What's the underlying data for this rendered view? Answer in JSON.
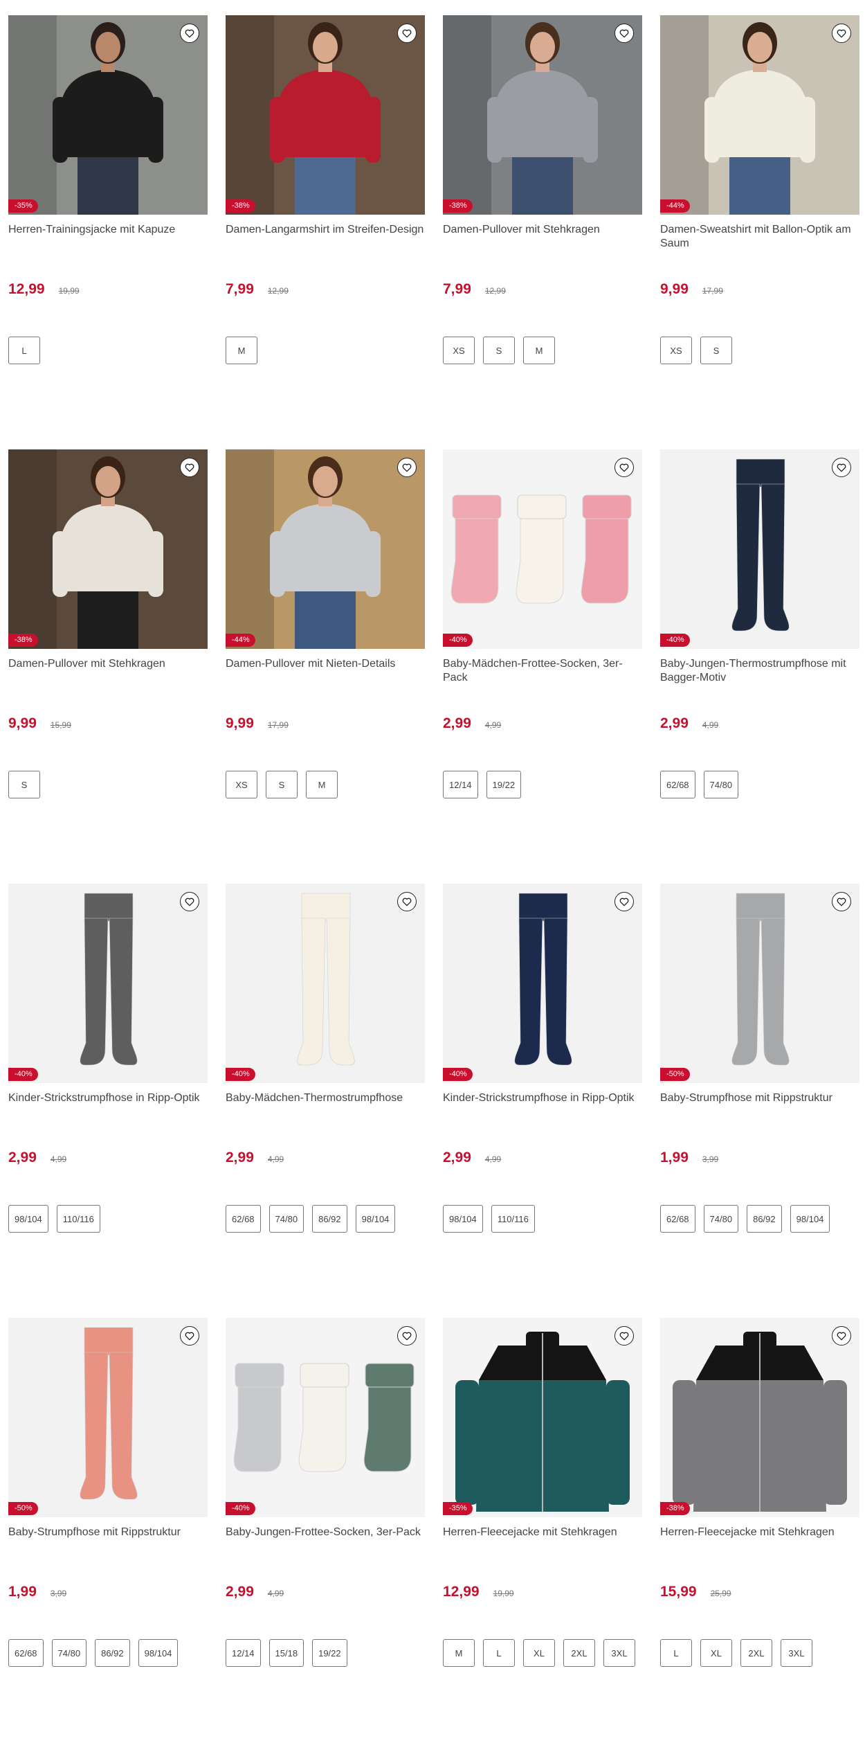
{
  "products": [
    {
      "title": "Herren-Trainingsjacke mit Kapuze",
      "price": "12,99",
      "old_price": "19,99",
      "discount": "-35%",
      "sizes": [
        "L"
      ],
      "image_kind": "person",
      "colors": {
        "bg": "#8d8f8b",
        "top": "#1c1c1c",
        "bottom": "#2f3748",
        "skin": "#b9876a",
        "hair": "#2a1f1a"
      }
    },
    {
      "title": "Damen-Langarmshirt im Streifen-Design",
      "price": "7,99",
      "old_price": "12,99",
      "discount": "-38%",
      "sizes": [
        "M"
      ],
      "image_kind": "person",
      "colors": {
        "bg": "#6b5544",
        "top": "#b81c2e",
        "bottom": "#4e6a92",
        "skin": "#d8a98c",
        "hair": "#3a2418"
      }
    },
    {
      "title": "Damen-Pullover mit Stehkragen",
      "price": "7,99",
      "old_price": "12,99",
      "discount": "-38%",
      "sizes": [
        "XS",
        "S",
        "M"
      ],
      "image_kind": "person",
      "colors": {
        "bg": "#7d8184",
        "top": "#9a9ea3",
        "bottom": "#3d5070",
        "skin": "#d8ab92",
        "hair": "#4a2e1e"
      }
    },
    {
      "title": "Damen-Sweatshirt mit Ballon-Optik am Saum",
      "price": "9,99",
      "old_price": "17,99",
      "discount": "-44%",
      "sizes": [
        "XS",
        "S"
      ],
      "image_kind": "person",
      "colors": {
        "bg": "#c9c3b6",
        "top": "#efece0",
        "bottom": "#465f86",
        "skin": "#d9ae93",
        "hair": "#3a2619"
      }
    },
    {
      "title": "Damen-Pullover mit Stehkragen",
      "price": "9,99",
      "old_price": "15,99",
      "discount": "-38%",
      "sizes": [
        "S"
      ],
      "image_kind": "person",
      "colors": {
        "bg": "#5b4a3c",
        "top": "#e6e2da",
        "bottom": "#1d1d1d",
        "skin": "#d2a387",
        "hair": "#3b2416"
      }
    },
    {
      "title": "Damen-Pullover mit Nieten-Details",
      "price": "9,99",
      "old_price": "17,99",
      "discount": "-44%",
      "sizes": [
        "XS",
        "S",
        "M"
      ],
      "image_kind": "person",
      "colors": {
        "bg": "#b99767",
        "top": "#c9cbce",
        "bottom": "#3e5880",
        "skin": "#d9ab8e",
        "hair": "#4b2c1b"
      }
    },
    {
      "title": "Baby-Mädchen-Frottee-Socken, 3er-Pack",
      "price": "2,99",
      "old_price": "4,99",
      "discount": "-40%",
      "sizes": [
        "12/14",
        "19/22"
      ],
      "image_kind": "socks",
      "colors": {
        "a": "#f0a8b2",
        "b": "#f7f3ea",
        "c": "#ee9eab"
      }
    },
    {
      "title": "Baby-Jungen-Thermostrumpfhose mit Bagger-Motiv",
      "price": "2,99",
      "old_price": "4,99",
      "discount": "-40%",
      "sizes": [
        "62/68",
        "74/80"
      ],
      "image_kind": "tights",
      "colors": {
        "main": "#1f2a3e"
      }
    },
    {
      "title": "Kinder-Strickstrumpfhose in Ripp-Optik",
      "price": "2,99",
      "old_price": "4,99",
      "discount": "-40%",
      "sizes": [
        "98/104",
        "110/116"
      ],
      "image_kind": "tights",
      "colors": {
        "main": "#5e5e5e"
      }
    },
    {
      "title": "Baby-Mädchen-Thermostrumpfhose",
      "price": "2,99",
      "old_price": "4,99",
      "discount": "-40%",
      "sizes": [
        "62/68",
        "74/80",
        "86/92",
        "98/104"
      ],
      "image_kind": "tights",
      "colors": {
        "main": "#f6f0e4"
      }
    },
    {
      "title": "Kinder-Strickstrumpfhose in Ripp-Optik",
      "price": "2,99",
      "old_price": "4,99",
      "discount": "-40%",
      "sizes": [
        "98/104",
        "110/116"
      ],
      "image_kind": "tights",
      "colors": {
        "main": "#1c2a4e"
      }
    },
    {
      "title": "Baby-Strumpfhose mit Rippstruktur",
      "price": "1,99",
      "old_price": "3,99",
      "discount": "-50%",
      "sizes": [
        "62/68",
        "74/80",
        "86/92",
        "98/104"
      ],
      "image_kind": "tights",
      "colors": {
        "main": "#a7a8aa"
      }
    },
    {
      "title": "Baby-Strumpfhose mit Rippstruktur",
      "price": "1,99",
      "old_price": "3,99",
      "discount": "-50%",
      "sizes": [
        "62/68",
        "74/80",
        "86/92",
        "98/104"
      ],
      "image_kind": "tights",
      "colors": {
        "main": "#e79282"
      }
    },
    {
      "title": "Baby-Jungen-Frottee-Socken, 3er-Pack",
      "price": "2,99",
      "old_price": "4,99",
      "discount": "-40%",
      "sizes": [
        "12/14",
        "15/18",
        "19/22"
      ],
      "image_kind": "socks",
      "colors": {
        "a": "#c7c9cc",
        "b": "#f4f2ea",
        "c": "#5f7a6f"
      }
    },
    {
      "title": "Herren-Fleecejacke mit Stehkragen",
      "price": "12,99",
      "old_price": "19,99",
      "discount": "-35%",
      "sizes": [
        "M",
        "L",
        "XL",
        "2XL",
        "3XL"
      ],
      "image_kind": "jacket",
      "colors": {
        "main": "#1f5a5c",
        "accent": "#141414"
      }
    },
    {
      "title": "Herren-Fleecejacke mit Stehkragen",
      "price": "15,99",
      "old_price": "25,99",
      "discount": "-38%",
      "sizes": [
        "L",
        "XL",
        "2XL",
        "3XL"
      ],
      "image_kind": "jacket",
      "colors": {
        "main": "#7a7a7c",
        "accent": "#151515"
      }
    }
  ],
  "icons": {
    "favorite": "heart-outline-icon"
  },
  "colors": {
    "price": "#c8102e",
    "badge": "#c8102e"
  }
}
